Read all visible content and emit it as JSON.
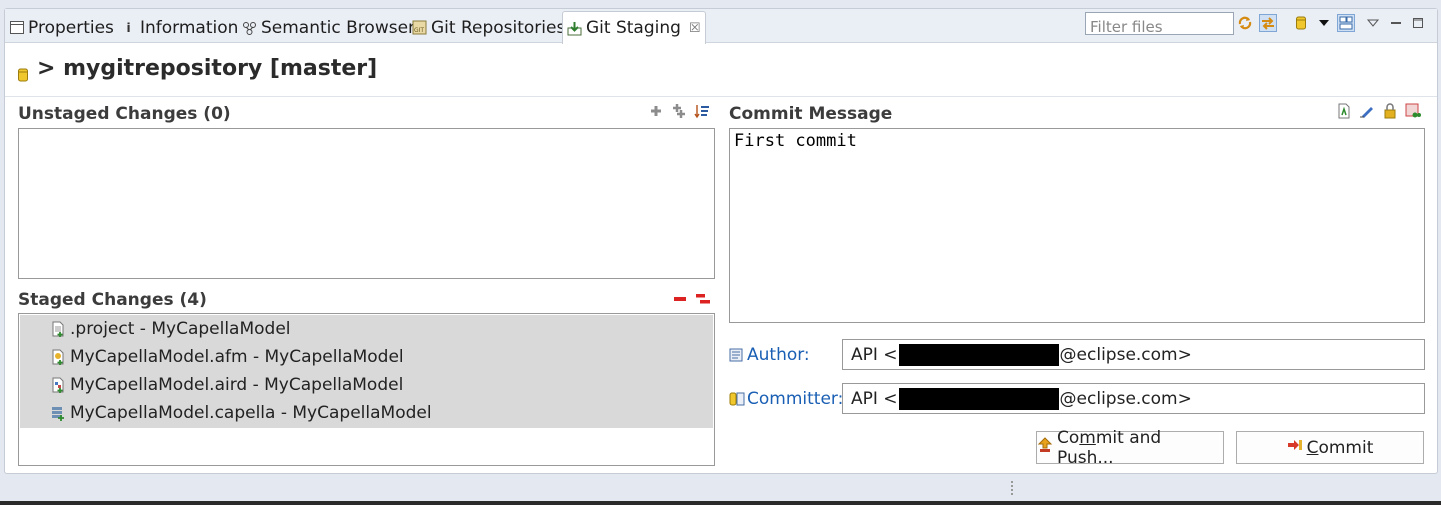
{
  "tabs": [
    {
      "label": "Properties",
      "icon": "properties-icon"
    },
    {
      "label": "Information",
      "icon": "info-icon"
    },
    {
      "label": "Semantic Browser",
      "icon": "semantic-browser-icon"
    },
    {
      "label": "Git Repositories",
      "icon": "git-repositories-icon"
    },
    {
      "label": "Git Staging",
      "icon": "git-staging-icon",
      "active": true,
      "close": "☒"
    }
  ],
  "toolbar": {
    "filter_placeholder": "Filter files"
  },
  "repository": {
    "title": "> mygitrepository [master]"
  },
  "unstaged": {
    "title": "Unstaged Changes (0)"
  },
  "staged": {
    "title": "Staged Changes (4)",
    "files": [
      {
        "name": ".project - MyCapellaModel"
      },
      {
        "name": "MyCapellaModel.afm - MyCapellaModel"
      },
      {
        "name": "MyCapellaModel.aird - MyCapellaModel"
      },
      {
        "name": "MyCapellaModel.capella - MyCapellaModel"
      }
    ]
  },
  "commit": {
    "title": "Commit Message",
    "message": "First commit",
    "author_label": "Author:",
    "author_prefix": "API <",
    "author_suffix": "@eclipse.com>",
    "committer_label": "Committer:",
    "committer_prefix": "API <",
    "committer_suffix": "@eclipse.com>",
    "commit_and_push_pre": "Co",
    "commit_and_push_u": "m",
    "commit_and_push_post": "mit and Push...",
    "commit_u": "C",
    "commit_post": "ommit"
  }
}
